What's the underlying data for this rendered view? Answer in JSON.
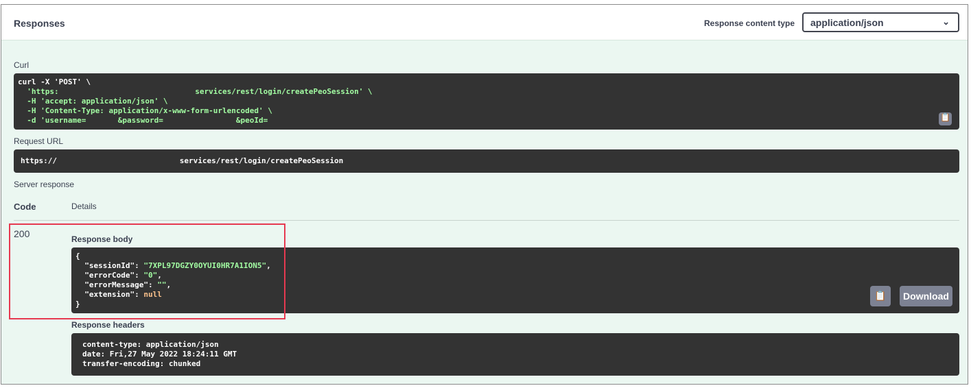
{
  "header": {
    "title": "Responses",
    "content_type_label": "Response content type",
    "content_type_value": "application/json"
  },
  "curl": {
    "label": "Curl",
    "lines": [
      "curl -X 'POST' \\",
      "  'https:                              services/rest/login/createPeoSession' \\",
      "  -H 'accept: application/json' \\",
      "  -H 'Content-Type: application/x-www-form-urlencoded' \\",
      "  -d 'username=       &password=                &peoId="
    ]
  },
  "request_url": {
    "label": "Request URL",
    "value": "https://                           services/rest/login/createPeoSession"
  },
  "server_response": {
    "label": "Server response",
    "code_header": "Code",
    "details_header": "Details",
    "code": "200",
    "body_label": "Response body",
    "body": {
      "open": "{",
      "l1k": "  \"sessionId\": ",
      "l1v": "\"7XPL97DGZY0OYUI0HR7A1ION5\"",
      "l2k": "  \"errorCode\": ",
      "l2v": "\"0\"",
      "l3k": "  \"errorMessage\": ",
      "l3v": "\"\"",
      "l4k": "  \"extension\": ",
      "l4v": "null",
      "close": "}"
    },
    "download_label": "Download",
    "headers_label": "Response headers",
    "headers": [
      "content-type: application/json",
      "date: Fri,27 May 2022 18:24:11 GMT",
      "transfer-encoding: chunked"
    ]
  }
}
